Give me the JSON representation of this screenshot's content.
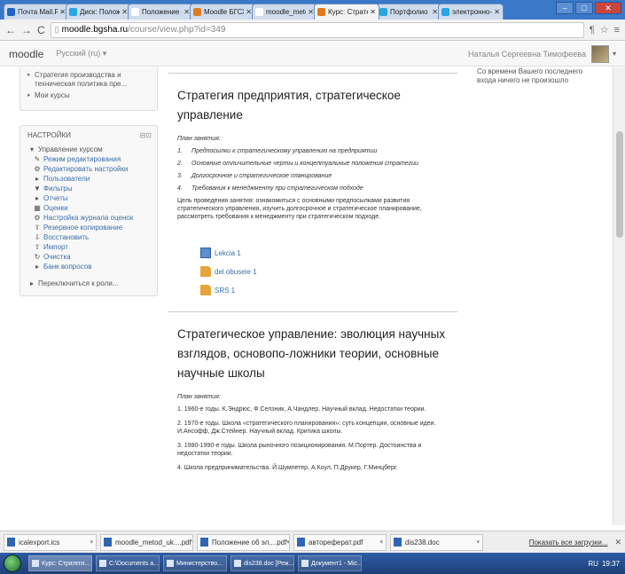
{
  "browser": {
    "tabs": [
      {
        "label": "Почта Mail.Ru",
        "color": "#1d64c4"
      },
      {
        "label": "Диск: Положе",
        "color": "#2aa6e0"
      },
      {
        "label": "Положение о",
        "color": "#ffffff"
      },
      {
        "label": "Moodle БГСХ",
        "color": "#e07b1d"
      },
      {
        "label": "moodle_metod",
        "color": "#ffffff"
      },
      {
        "label": "Курс: Страте",
        "color": "#e07b1d",
        "active": true
      },
      {
        "label": "Портфолио с",
        "color": "#2aa6e0"
      },
      {
        "label": "электронно-",
        "color": "#2aa6e0"
      }
    ],
    "url_host": "moodle.bgsha.ru",
    "url_path": "/course/view.php?id=349"
  },
  "moodle": {
    "logo": "moodle",
    "language": "Русский (ru) ▾",
    "user_name": "Наталья Сергеевна Тимофеева"
  },
  "sidebar": {
    "courses": [
      {
        "text": "Стратегия производства и техническая политика пре..."
      },
      {
        "text": "Мои курсы"
      }
    ],
    "settings_title": "НАСТРОЙКИ",
    "settings_controls": "⊟⊡",
    "course_admin": "Управление курсом",
    "items": [
      {
        "label": "Режим редактирования",
        "icon": "pencil-icon",
        "glyph": "✎"
      },
      {
        "label": "Редактировать настройки",
        "icon": "gear-icon",
        "glyph": "⚙"
      },
      {
        "label": "Пользователи",
        "icon": "expand-arrow-icon",
        "glyph": "▸"
      },
      {
        "label": "Фильтры",
        "icon": "filter-icon",
        "glyph": "▼"
      },
      {
        "label": "Отчеты",
        "icon": "expand-arrow-icon",
        "glyph": "▸"
      },
      {
        "label": "Оценки",
        "icon": "grades-icon",
        "glyph": "▦"
      },
      {
        "label": "Настройка журнала оценок",
        "icon": "gear-icon",
        "glyph": "⚙"
      },
      {
        "label": "Резервное копирование",
        "icon": "upload-icon",
        "glyph": "⇪"
      },
      {
        "label": "Восстановить",
        "icon": "restore-icon",
        "glyph": "⇩"
      },
      {
        "label": "Импорт",
        "icon": "import-icon",
        "glyph": "⇧"
      },
      {
        "label": "Очистка",
        "icon": "reset-icon",
        "glyph": "↻"
      },
      {
        "label": "Банк вопросов",
        "icon": "expand-arrow-icon",
        "glyph": "▸"
      }
    ],
    "switch_role": "Переключиться к роли..."
  },
  "right_block": {
    "line1": "Со времени Вашего последнего",
    "line2": "входа ничего не произошло"
  },
  "sections": [
    {
      "title": "Стратегия предприятия, стратегическое управление",
      "plan_heading": "План занятия:",
      "plan": [
        {
          "n": "1.",
          "text": "Предпосылки к стратегическому управлению на предприятии"
        },
        {
          "n": "2.",
          "text": "Основные отличительные черты и концептуальные положения стратегии"
        },
        {
          "n": "3.",
          "text": "Долгосрочное и стратегическое планирование"
        },
        {
          "n": "4.",
          "text": "Требования к менеджменту при стратегическом подходе"
        }
      ],
      "goal": "Цель проведения занятия: ознакомиться с основными предпосылками развития стратегического управления, изучить долгосрочное и стратегическое планирование, рассмотреть требования к менеджменту при стратегическом подходе.",
      "resources": [
        {
          "label": "Lekcia 1",
          "icon": "document-icon"
        },
        {
          "label": "del obuseie 1",
          "icon": "folder-icon"
        },
        {
          "label": "SRS 1",
          "icon": "folder-icon"
        }
      ]
    },
    {
      "title": "Стратегическое управление: эволюция научных взглядов, основопо-ложники теории, основные научные школы",
      "plan_heading": "План занятия:",
      "paras": [
        "1. 1960-е годы. К.Эндрюс, Ф.Селзник, А.Чандлер. Научный вклад. Недостатки теории.",
        "2. 1970-е годы. Школа «стратегического планирования»: суть концепции, основные идеи. И.Ансофф, Дж.Стейнер. Научный вклад. Критика школы.",
        "3. 1980-1990-е годы. Школа рыночного позиционирования. М.Портер. Достоинства и недостатки теории.",
        "4. Школа предпринимательства. Й.Шумпетер, А.Коул, П.Друкер, Г.Минцберг."
      ]
    }
  ],
  "downloads": {
    "items": [
      {
        "label": "icalexport.ics"
      },
      {
        "label": "moodle_metod_uk....pdf"
      },
      {
        "label": "Положение об эл....pdf"
      },
      {
        "label": "автореферат.pdf"
      },
      {
        "label": "dis238.doc"
      }
    ],
    "show_all": "Показать все загрузки..."
  },
  "taskbar": {
    "items": [
      {
        "label": "Курс: Стратеги...",
        "active": true
      },
      {
        "label": "C:\\Documents a..."
      },
      {
        "label": "Министерство..."
      },
      {
        "label": "dis238.doc [Реж..."
      },
      {
        "label": "Документ1 - Mic..."
      }
    ],
    "clock": "19:37",
    "lang": "RU"
  }
}
